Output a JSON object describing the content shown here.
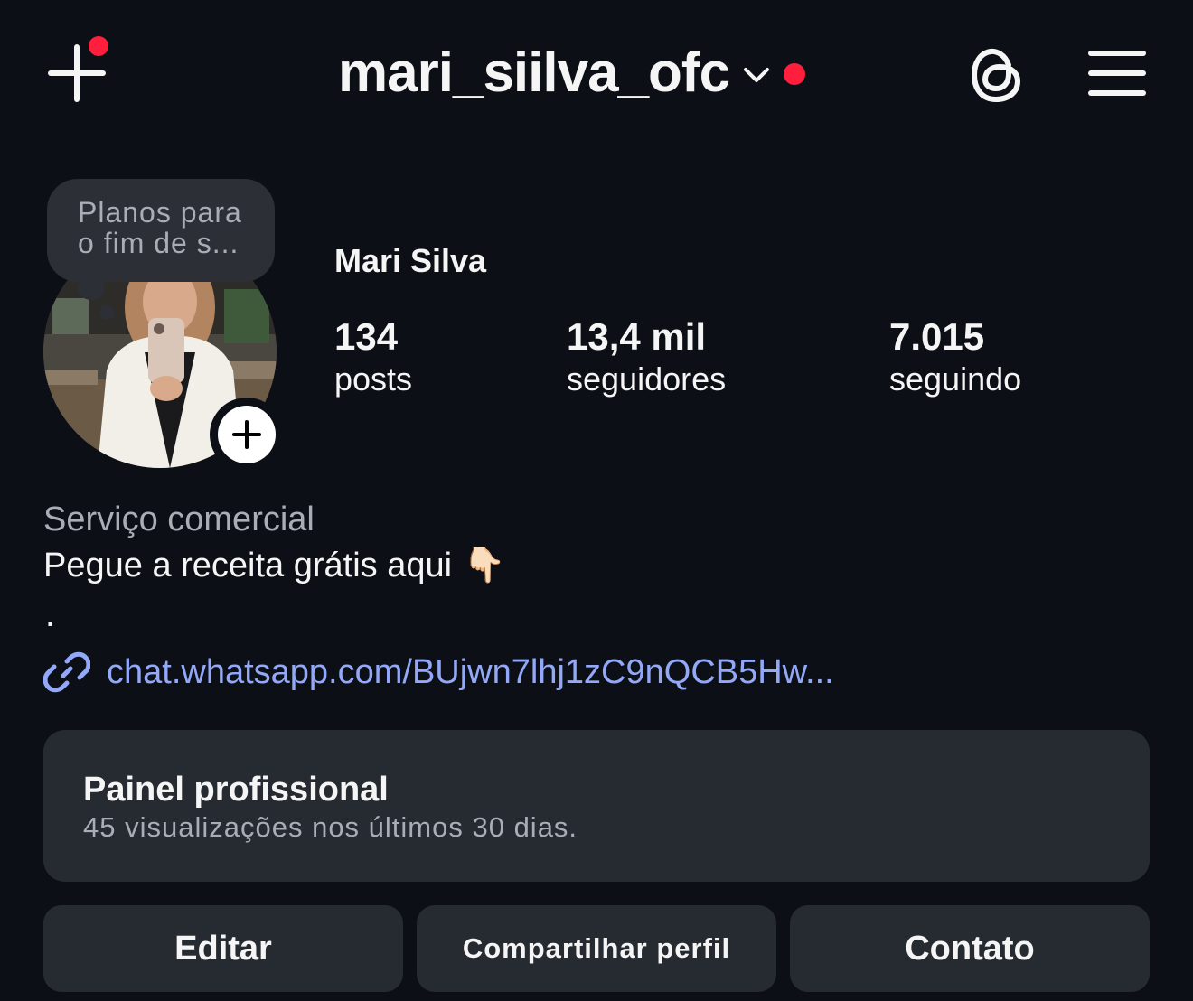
{
  "header": {
    "username": "mari_siilva_ofc",
    "icons": [
      "plus-icon",
      "chevron-down-icon",
      "threads-icon",
      "menu-icon"
    ],
    "notification_color": "#ff1f3d"
  },
  "note": {
    "line1": "Planos para",
    "line2": "o fim de s..."
  },
  "profile": {
    "display_name": "Mari Silva",
    "stats": {
      "posts_count": "134",
      "posts_label": "posts",
      "followers_count": "13,4 mil",
      "followers_label": "seguidores",
      "following_count": "7.015",
      "following_label": "seguindo"
    }
  },
  "bio": {
    "category": "Serviço comercial",
    "text": "Pegue a receita grátis aqui",
    "emoji": "👇🏻",
    "extra_line": ".",
    "link": "chat.whatsapp.com/BUjwn7lhj1zC9nQCB5Hw...",
    "link_color": "#93a8f8"
  },
  "professional_panel": {
    "title": "Painel profissional",
    "subtitle": "45 visualizações nos últimos 30 dias."
  },
  "actions": {
    "edit": "Editar",
    "share": "Compartilhar perfil",
    "contact": "Contato"
  }
}
